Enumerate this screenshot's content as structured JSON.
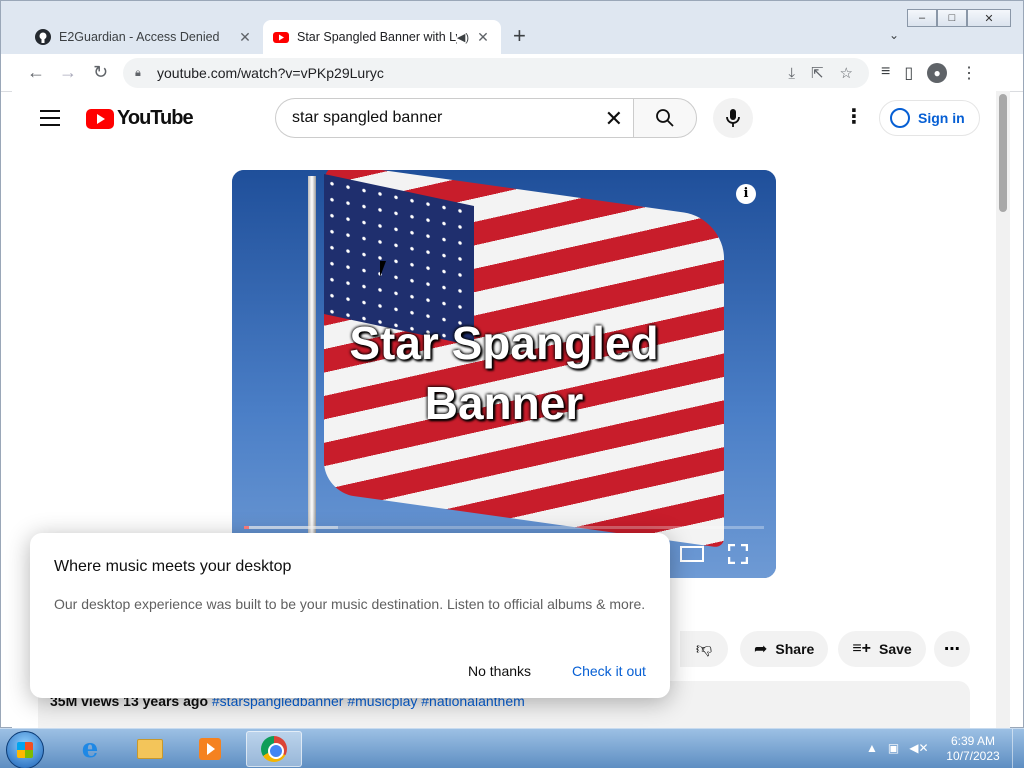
{
  "window": {
    "controls": [
      "–",
      "□",
      "✕"
    ]
  },
  "tabs": [
    {
      "title": "E2Guardian - Access Denied",
      "active": false
    },
    {
      "title": "Star Spangled Banner with Ly",
      "active": true
    }
  ],
  "address_bar": {
    "url": "youtube.com/watch?v=vPKp29Luryc"
  },
  "youtube": {
    "logo_text": "YouTube",
    "search": {
      "query": "star spangled banner"
    },
    "sign_in_label": "Sign in"
  },
  "video": {
    "overlay_title_line1": "Star Spangled",
    "overlay_title_line2": "Banner",
    "progress_fraction": 0.01
  },
  "actions": {
    "share_label": "Share",
    "save_label": "Save"
  },
  "description": {
    "views": "35M views",
    "age": "13 years ago",
    "hashtags": [
      "#starspangledbanner",
      "#musicplay",
      "#nationalanthem"
    ]
  },
  "dialog": {
    "heading": "Where music meets your desktop",
    "body": "Our desktop experience was built to be your music destination. Listen to official albums & more.",
    "dismiss_label": "No thanks",
    "confirm_label": "Check it out"
  },
  "taskbar": {
    "time": "6:39 AM",
    "date": "10/7/2023"
  },
  "colors": {
    "youtube_red": "#ff0000",
    "link_blue": "#065fd4"
  }
}
